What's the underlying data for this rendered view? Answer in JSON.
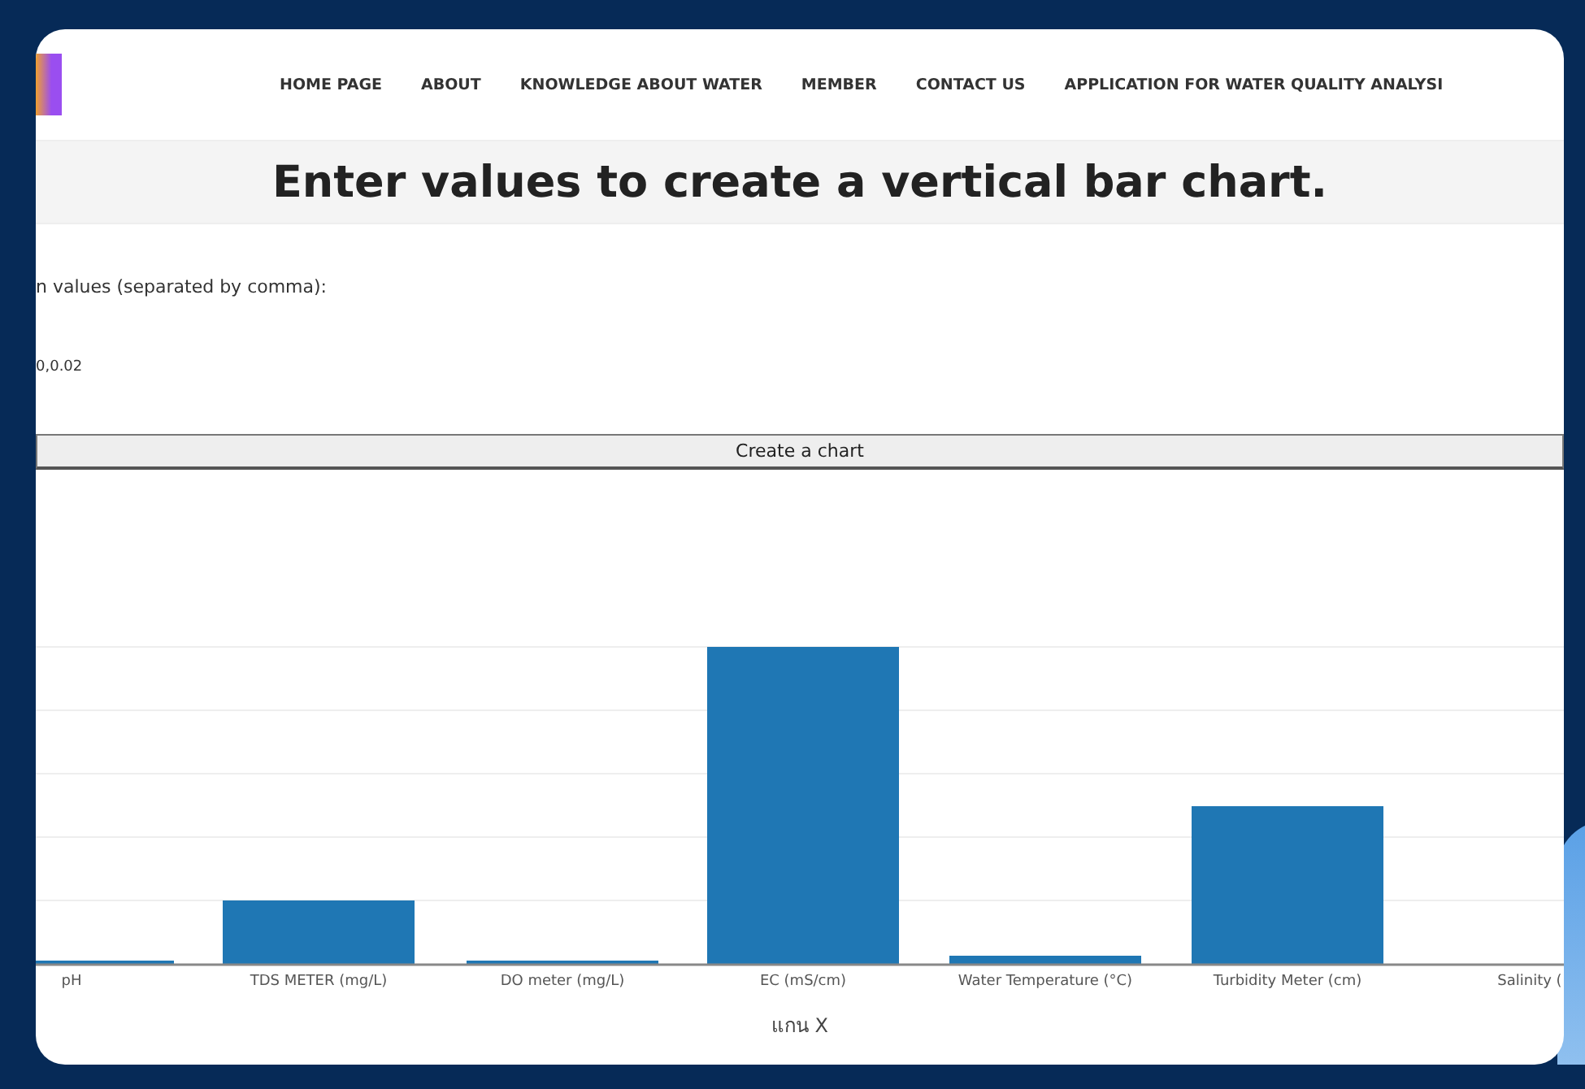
{
  "nav": {
    "items": [
      "HOME PAGE",
      "ABOUT",
      "KNOWLEDGE ABOUT WATER",
      "MEMBER",
      "CONTACT US",
      "APPLICATION FOR WATER QUALITY ANALYSI"
    ]
  },
  "heading": "Enter values to create a vertical bar chart.",
  "form": {
    "label": "n values (separated by comma):",
    "value": "0,0.02",
    "button": "Create a chart"
  },
  "chart": {
    "x_labels": [
      "pH",
      "TDS METER (mg/L)",
      "DO meter (mg/L)",
      "EC (mS/cm)",
      "Water Temperature (°C)",
      "Turbidity Meter (cm)",
      "Salinity ("
    ],
    "x_title": "แกน X"
  }
}
